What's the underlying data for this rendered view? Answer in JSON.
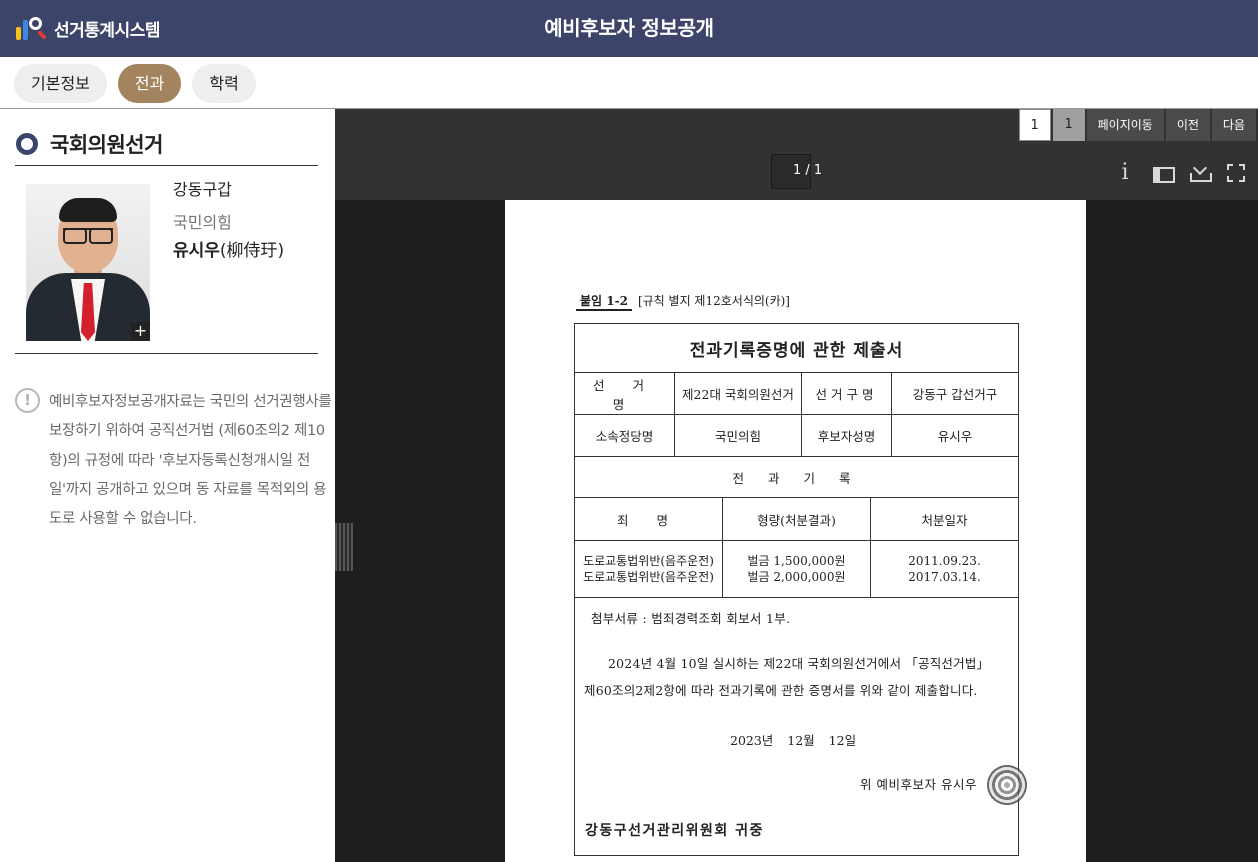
{
  "app": {
    "logo_text": "선거통계시스템",
    "page_title": "예비후보자 정보공개",
    "header_bg": "#3c4469"
  },
  "tabs": [
    {
      "label": "기본정보",
      "active": false
    },
    {
      "label": "전과",
      "active": true
    },
    {
      "label": "학력",
      "active": false
    }
  ],
  "tab_active_color": "#a4845e",
  "candidate": {
    "election": "국회의원선거",
    "district": "강동구갑",
    "party": "국민의힘",
    "name": "유시우",
    "name_hanja": "(柳侍玗)",
    "photo_zoom_label": "+"
  },
  "notice": {
    "icon": "!",
    "text": "예비후보자정보공개자료는 국민의 선거권행사를 보장하기 위하여 공직선거법 (제60조의2 제10항)의 규정에 따라 '후보자등록신청개시일 전일'까지 공개하고 있으며 동 자료를 목적외의 용도로 사용할 수 없습니다."
  },
  "viewer": {
    "page_input": "1",
    "page_number": "1",
    "goto_label": "페이지이동",
    "prev_label": "이전",
    "next_label": "다음",
    "page_indicator": "1 / 1",
    "info_icon": "i"
  },
  "document": {
    "form_code_box": "붙임 1-2",
    "form_code_text": "[규칙 별지 제12호서식의(카)]",
    "title": "전과기록증명에 관한 제출서",
    "labels": {
      "election_name": "선 거 명",
      "district_name": "선거구명",
      "party_name": "소속정당명",
      "candidate_name": "후보자성명",
      "record_header": "전 과 기 록",
      "crime": "죄 명",
      "penalty": "형량(처분결과)",
      "date": "처분일자"
    },
    "values": {
      "election_name": "제22대 국회의원선거",
      "district_name": "강동구 갑선거구",
      "party_name": "국민의힘",
      "candidate_name": "유시우"
    },
    "records": [
      {
        "crime": "도로교통법위반(음주운전)",
        "penalty": "벌금 1,500,000원",
        "date": "2011.09.23."
      },
      {
        "crime": "도로교통법위반(음주운전)",
        "penalty": "벌금 2,000,000원",
        "date": "2017.03.14."
      }
    ],
    "attachment": "첨부서류 : 범죄경력조회 회보서 1부.",
    "statement_line1": "2024년 4월 10일 실시하는 제22대 국회의원선거에서 「공직선거법」",
    "statement_line2": "제60조의2제2항에 따라 전과기록에 관한 증명서를 위와 같이 제출합니다.",
    "date": "2023년 12월 12일",
    "signer": "위 예비후보자 유시우",
    "committee": "강동구선거관리위원회 귀중"
  }
}
